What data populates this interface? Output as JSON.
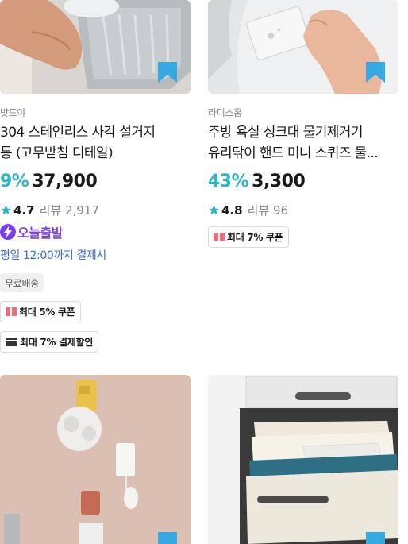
{
  "products": [
    {
      "brand": "밧드야",
      "title_lines": [
        "304 스테인리스 사각 설거지",
        "통 (고무받침 디테일)"
      ],
      "discount": "9%",
      "price": "37,900",
      "rating": "4.7",
      "reviews": "리뷰 2,917",
      "delivery_badge": "오늘출발",
      "delivery_deadline": "평일 12:00까지 결제시",
      "free_shipping": "무료배송",
      "coupon": "최대 5% 쿠폰",
      "payment_discount": "최대 7% 결제할인"
    },
    {
      "brand": "라미스홈",
      "title_lines": [
        "주방 욕실 싱크대 물기제거기",
        "유리닦이 핸드 미니 스퀴즈 물..."
      ],
      "discount": "43%",
      "price": "3,300",
      "rating": "4.8",
      "reviews": "리뷰 96",
      "coupon": "최대 7% 쿠폰"
    }
  ],
  "icons": {
    "bookmark": "bookmark-icon",
    "star": "star-icon",
    "bolt": "lightning-icon",
    "coupon": "coupon-icon",
    "card": "credit-card-icon"
  },
  "colors": {
    "discount": "#2cb4c8",
    "bookmark": "#35a9e0",
    "star": "#2cb4c8",
    "today_delivery": "#7b3fe4",
    "deadline": "#3a6bd6",
    "coupon_icon": "#f06b7a"
  }
}
